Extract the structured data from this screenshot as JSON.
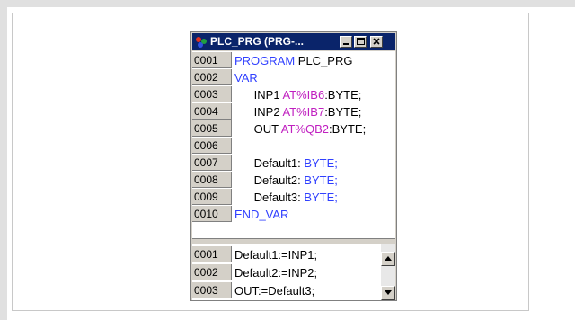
{
  "window": {
    "title": "PLC_PRG (PRG-..."
  },
  "colors": {
    "titlebar": "#0a246a",
    "keyword": "#3040ff",
    "address": "#c020c0",
    "gutter": "#d4d0c8"
  },
  "declaration": {
    "lines": [
      {
        "no": "0001",
        "indent": "",
        "a": "PROGRAM",
        "b": " PLC_PRG",
        "c": "",
        "d": ""
      },
      {
        "no": "0002",
        "indent": "",
        "a": "VAR",
        "b": "",
        "c": "",
        "d": ""
      },
      {
        "no": "0003",
        "indent": "      ",
        "a": "",
        "b": "INP1 ",
        "c": "AT%IB6",
        "d": ":BYTE;"
      },
      {
        "no": "0004",
        "indent": "      ",
        "a": "",
        "b": "INP2 ",
        "c": "AT%IB7",
        "d": ":BYTE;"
      },
      {
        "no": "0005",
        "indent": "      ",
        "a": "",
        "b": "OUT ",
        "c": "AT%QB2",
        "d": ":BYTE;"
      },
      {
        "no": "0006",
        "indent": "",
        "a": "",
        "b": "",
        "c": "",
        "d": ""
      },
      {
        "no": "0007",
        "indent": "      ",
        "a": "",
        "b": "Default1: ",
        "c": "",
        "d": "BYTE;"
      },
      {
        "no": "0008",
        "indent": "      ",
        "a": "",
        "b": "Default2: ",
        "c": "",
        "d": "BYTE;"
      },
      {
        "no": "0009",
        "indent": "      ",
        "a": "",
        "b": "Default3: ",
        "c": "",
        "d": "BYTE;"
      },
      {
        "no": "0010",
        "indent": "",
        "a": "END_VAR",
        "b": "",
        "c": "",
        "d": ""
      }
    ]
  },
  "body": {
    "lines": [
      {
        "no": "0001",
        "text": "Default1:=INP1;"
      },
      {
        "no": "0002",
        "text": "Default2:=INP2;"
      },
      {
        "no": "0003",
        "text": "OUT:=Default3;"
      }
    ]
  }
}
